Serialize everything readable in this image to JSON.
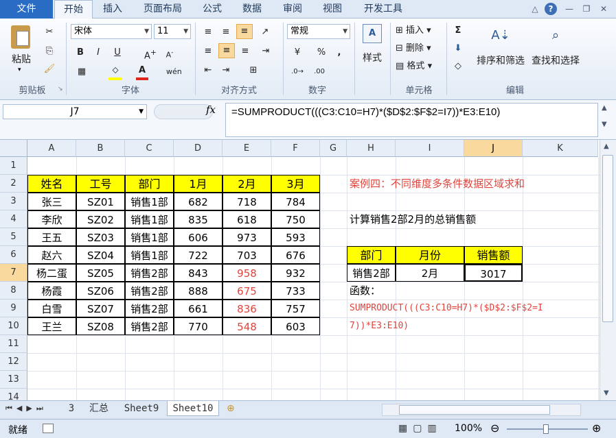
{
  "tabs": [
    "文件",
    "开始",
    "插入",
    "页面布局",
    "公式",
    "数据",
    "审阅",
    "视图",
    "开发工具"
  ],
  "ribbon": {
    "paste": "粘贴",
    "clipboard_group": "剪贴板",
    "font_name": "宋体",
    "font_size": "11",
    "font_group": "字体",
    "align_group": "对齐方式",
    "number_format": "常规",
    "number_group": "数字",
    "styles": "样式",
    "insert": "插入",
    "delete": "删除",
    "format": "格式",
    "cells_group": "单元格",
    "sort_filter": "排序和筛选",
    "find_select": "查找和选择",
    "editing_group": "编辑"
  },
  "formula_bar": {
    "name_box": "J7",
    "fx": "fx",
    "formula": "=SUMPRODUCT(((C3:C10=H7)*($D$2:$F$2=I7))*E3:E10)"
  },
  "columns": [
    "A",
    "B",
    "C",
    "D",
    "E",
    "F",
    "G",
    "H",
    "I",
    "J",
    "K"
  ],
  "rows": [
    "1",
    "2",
    "3",
    "4",
    "5",
    "6",
    "7",
    "8",
    "9",
    "10",
    "11",
    "12",
    "13",
    "14"
  ],
  "table": {
    "headers": [
      "姓名",
      "工号",
      "部门",
      "1月",
      "2月",
      "3月"
    ],
    "rows": [
      [
        "张三",
        "SZ01",
        "销售1部",
        "682",
        "718",
        "784"
      ],
      [
        "李欣",
        "SZ02",
        "销售1部",
        "835",
        "618",
        "750"
      ],
      [
        "王五",
        "SZ03",
        "销售1部",
        "606",
        "973",
        "593"
      ],
      [
        "赵六",
        "SZ04",
        "销售1部",
        "722",
        "703",
        "676"
      ],
      [
        "杨二蛋",
        "SZ05",
        "销售2部",
        "843",
        "958",
        "932"
      ],
      [
        "杨霞",
        "SZ06",
        "销售2部",
        "888",
        "675",
        "733"
      ],
      [
        "白雪",
        "SZ07",
        "销售2部",
        "661",
        "836",
        "757"
      ],
      [
        "王兰",
        "SZ08",
        "销售2部",
        "770",
        "548",
        "603"
      ]
    ]
  },
  "case_title": "案例四：不同维度多条件数据区域求和",
  "task": "计算销售2部2月的总销售额",
  "criteria": {
    "headers": [
      "部门",
      "月份",
      "销售额"
    ],
    "values": [
      "销售2部",
      "2月",
      "3017"
    ]
  },
  "func_label": "函数：",
  "func_line1": "SUMPRODUCT(((C3:C10=H7)*($D$2:$F$2=I",
  "func_line2": "7))*E3:E10)",
  "sheets": [
    "3",
    "汇总",
    "Sheet9",
    "Sheet10"
  ],
  "status": {
    "ready": "就绪",
    "zoom": "100%"
  },
  "colors": {
    "yellow": "#ffff00",
    "red": "#e0443c",
    "accent": "#2a6cc4"
  }
}
